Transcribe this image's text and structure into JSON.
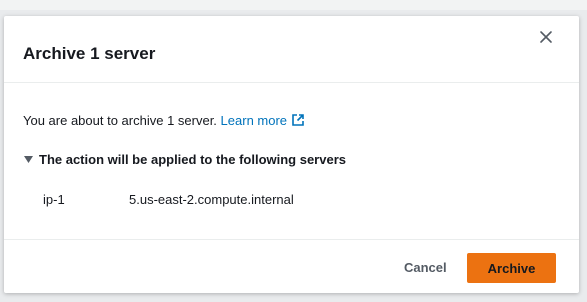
{
  "modal": {
    "title": "Archive 1 server",
    "close_icon": "close-icon",
    "intro_text": "You are about to archive 1 server.",
    "learn_more_label": "Learn more",
    "external_link_icon": "external-link-icon",
    "expander_label": "The action will be applied to the following servers",
    "expander_icon": "caret-down-icon",
    "servers": [
      {
        "prefix": "ip-1",
        "suffix": "5.us-east-2.compute.internal"
      }
    ],
    "cancel_label": "Cancel",
    "archive_label": "Archive"
  },
  "colors": {
    "primary_button": "#ec7211",
    "link": "#0073bb",
    "text": "#16191f"
  }
}
